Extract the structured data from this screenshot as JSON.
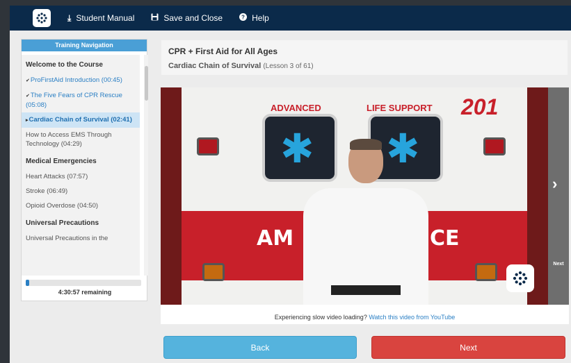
{
  "topbar": {
    "student_manual": "Student Manual",
    "save_and_close": "Save and Close",
    "help": "Help"
  },
  "sidebar": {
    "header": "Training Navigation",
    "sections": [
      {
        "title": "Welcome to the Course",
        "items": [
          {
            "label": "ProFirstAid Introduction (00:45)",
            "state": "done"
          },
          {
            "label": "The Five Fears of CPR Rescue (05:08)",
            "state": "done"
          },
          {
            "label": "Cardiac Chain of Survival (02:41)",
            "state": "active"
          },
          {
            "label": "How to Access EMS Through Technology (04:29)",
            "state": "todo"
          }
        ]
      },
      {
        "title": "Medical Emergencies",
        "items": [
          {
            "label": "Heart Attacks (07:57)",
            "state": "todo"
          },
          {
            "label": "Stroke (06:49)",
            "state": "todo"
          },
          {
            "label": "Opioid Overdose (04:50)",
            "state": "todo"
          }
        ]
      },
      {
        "title": "Universal Precautions",
        "items": [
          {
            "label": "Universal Precautions in the",
            "state": "todo"
          }
        ]
      }
    ],
    "progress_fraction": 0.03,
    "remaining": "4:30:57 remaining"
  },
  "lesson": {
    "course_title": "CPR + First Aid for All Ages",
    "lesson_title": "Cardiac Chain of Survival",
    "lesson_count": "(Lesson 3 of 61)"
  },
  "video": {
    "sign_advanced": "ADVANCED",
    "sign_life_support": "LIFE SUPPORT",
    "unit_number": "201",
    "side_text_left": "AM",
    "side_text_right": "CE",
    "next_side_label": "Next"
  },
  "slow_notice": {
    "text": "Experiencing slow video loading?",
    "link": "Watch this video from YouTube"
  },
  "buttons": {
    "back": "Back",
    "next": "Next"
  },
  "colors": {
    "topbar": "#0b2a4a",
    "accent_blue": "#4a9fd6",
    "back_button": "#55b3dd",
    "next_button": "#d9443f"
  }
}
